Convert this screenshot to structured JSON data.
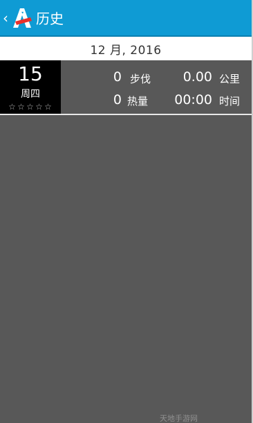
{
  "header": {
    "back_icon": "chevron-left-icon",
    "logo": "app-logo-a",
    "title": "历史",
    "color": "#0f9bd4"
  },
  "month": {
    "label": "12 月, 2016"
  },
  "days": [
    {
      "day": "15",
      "weekday": "周四",
      "stars_filled": 0,
      "stars_total": 5,
      "steps": {
        "value": "0",
        "unit": "步伐"
      },
      "distance": {
        "value": "0.00",
        "unit": "公里"
      },
      "calories": {
        "value": "0",
        "unit": "热量"
      },
      "duration": {
        "value": "00:00",
        "unit": "时间"
      }
    }
  ],
  "watermark": "天地手游网"
}
